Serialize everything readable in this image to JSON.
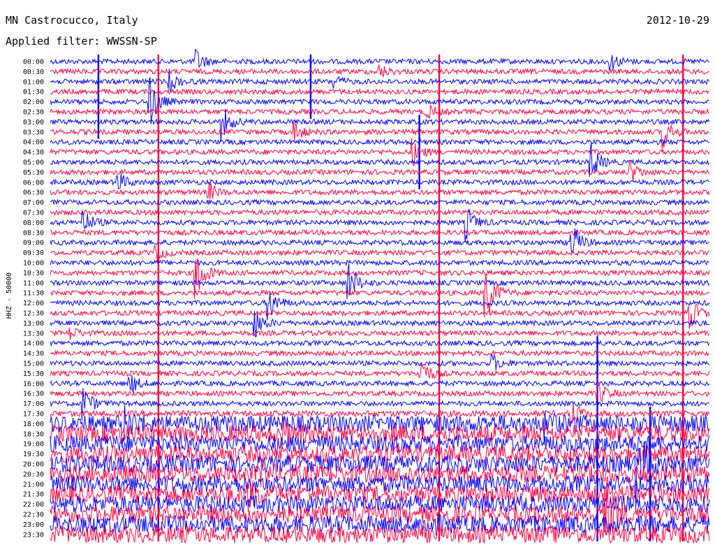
{
  "header": {
    "station": "MN Castrocucco, Italy",
    "date": "2012-10-29",
    "filter": "Applied filter: WWSSN-SP"
  },
  "chart_data": {
    "type": "line",
    "chart_kind": "helicorder",
    "ylabel": "HHZ - 50000",
    "tick_labels": [
      "00:00",
      "00:30",
      "01:00",
      "01:30",
      "02:00",
      "02:30",
      "03:00",
      "03:30",
      "04:00",
      "04:30",
      "05:00",
      "05:30",
      "06:00",
      "06:30",
      "07:00",
      "07:30",
      "08:00",
      "08:30",
      "09:00",
      "09:30",
      "10:00",
      "10:30",
      "11:00",
      "11:30",
      "12:00",
      "12:30",
      "13:00",
      "13:30",
      "14:00",
      "14:30",
      "15:00",
      "15:30",
      "16:00",
      "16:30",
      "17:00",
      "17:30",
      "18:00",
      "18:30",
      "19:00",
      "19:30",
      "20:00",
      "20:30",
      "21:00",
      "21:30",
      "22:00",
      "22:30",
      "23:00",
      "23:30"
    ],
    "colors": [
      "#0000ff",
      "#ff0040"
    ],
    "trace_amplitude": [
      0.25,
      0.25,
      0.25,
      0.25,
      0.25,
      0.25,
      0.25,
      0.25,
      0.25,
      0.25,
      0.25,
      0.25,
      0.25,
      0.25,
      0.25,
      0.25,
      0.25,
      0.25,
      0.25,
      0.25,
      0.25,
      0.25,
      0.25,
      0.25,
      0.25,
      0.25,
      0.25,
      0.25,
      0.25,
      0.25,
      0.25,
      0.25,
      0.25,
      0.25,
      0.25,
      0.3,
      0.85,
      0.85,
      0.85,
      0.85,
      0.85,
      0.85,
      0.85,
      0.85,
      0.85,
      0.85,
      0.85,
      0.85
    ],
    "events": [
      {
        "line": 0,
        "t": 0.22,
        "amp": 6
      },
      {
        "line": 0,
        "t": 0.85,
        "amp": 4
      },
      {
        "line": 1,
        "t": 0.5,
        "amp": 3
      },
      {
        "line": 2,
        "t": 0.18,
        "amp": 5
      },
      {
        "line": 2,
        "t": 0.43,
        "amp": 3
      },
      {
        "line": 4,
        "t": 0.15,
        "amp": 12
      },
      {
        "line": 5,
        "t": 0.57,
        "amp": 4
      },
      {
        "line": 6,
        "t": 0.26,
        "amp": 8
      },
      {
        "line": 7,
        "t": 0.37,
        "amp": 5
      },
      {
        "line": 7,
        "t": 0.93,
        "amp": 7
      },
      {
        "line": 9,
        "t": 0.55,
        "amp": 6
      },
      {
        "line": 10,
        "t": 0.82,
        "amp": 9
      },
      {
        "line": 11,
        "t": 0.88,
        "amp": 5
      },
      {
        "line": 12,
        "t": 0.1,
        "amp": 6
      },
      {
        "line": 13,
        "t": 0.24,
        "amp": 4
      },
      {
        "line": 16,
        "t": 0.05,
        "amp": 6
      },
      {
        "line": 16,
        "t": 0.63,
        "amp": 8
      },
      {
        "line": 18,
        "t": 0.79,
        "amp": 10
      },
      {
        "line": 19,
        "t": 0.16,
        "amp": 4
      },
      {
        "line": 21,
        "t": 0.22,
        "amp": 14
      },
      {
        "line": 22,
        "t": 0.45,
        "amp": 12
      },
      {
        "line": 23,
        "t": 0.66,
        "amp": 16
      },
      {
        "line": 24,
        "t": 0.33,
        "amp": 9
      },
      {
        "line": 25,
        "t": 0.97,
        "amp": 8
      },
      {
        "line": 26,
        "t": 0.31,
        "amp": 7
      },
      {
        "line": 27,
        "t": 0.03,
        "amp": 3
      },
      {
        "line": 30,
        "t": 0.67,
        "amp": 4
      },
      {
        "line": 31,
        "t": 0.56,
        "amp": 9
      },
      {
        "line": 32,
        "t": 0.12,
        "amp": 5
      },
      {
        "line": 33,
        "t": 0.83,
        "amp": 6
      },
      {
        "line": 34,
        "t": 0.05,
        "amp": 8
      },
      {
        "line": 35,
        "t": 0.79,
        "amp": 7
      },
      {
        "line": 36,
        "t": 0.11,
        "amp": 8
      },
      {
        "line": 36,
        "t": 0.75,
        "amp": 5
      },
      {
        "line": 37,
        "t": 0.35,
        "amp": 6
      },
      {
        "line": 40,
        "t": 0.89,
        "amp": 18
      },
      {
        "line": 41,
        "t": 0.32,
        "amp": 4
      },
      {
        "line": 43,
        "t": 0.3,
        "amp": 5
      },
      {
        "line": 45,
        "t": 0.84,
        "amp": 22
      },
      {
        "line": 46,
        "t": 0.57,
        "amp": 4
      }
    ],
    "spikes": [
      {
        "t": 0.164,
        "from_line": 0,
        "to_line": 47,
        "color": "#ff0040"
      },
      {
        "t": 0.59,
        "from_line": 0,
        "to_line": 47,
        "color": "#ff0040"
      },
      {
        "t": 0.96,
        "from_line": 0,
        "to_line": 47,
        "color": "#ff0040"
      },
      {
        "t": 0.073,
        "from_line": 0,
        "to_line": 7,
        "color": "#0000ff"
      },
      {
        "t": 0.395,
        "from_line": 0,
        "to_line": 5,
        "color": "#0000ff"
      },
      {
        "t": 0.56,
        "from_line": 6,
        "to_line": 12,
        "color": "#0000ff"
      },
      {
        "t": 0.83,
        "from_line": 28,
        "to_line": 47,
        "color": "#0000ff"
      },
      {
        "t": 0.91,
        "from_line": 35,
        "to_line": 47,
        "color": "#0000ff"
      }
    ]
  }
}
